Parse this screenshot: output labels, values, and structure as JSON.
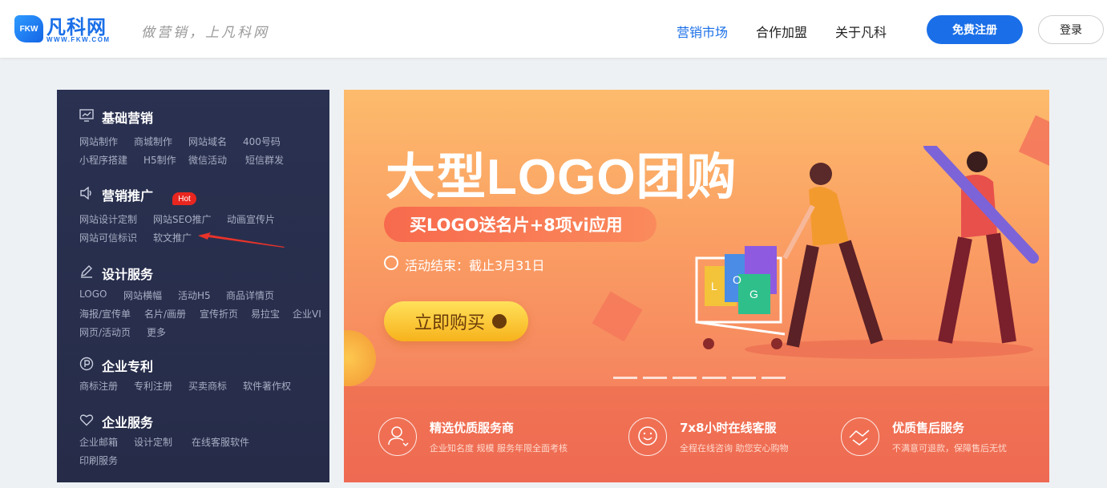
{
  "header": {
    "logo_badge": "FKW",
    "logo_name": "凡科网",
    "logo_url": "WWW.FKW.COM",
    "slogan": "做营销，上凡科网",
    "nav": [
      "营销市场",
      "合作加盟",
      "关于凡科"
    ],
    "register_label": "免费注册",
    "login_label": "登录"
  },
  "sidebar": {
    "categories": [
      {
        "title": "基础营销",
        "icon": "chart-icon",
        "links": [
          "网站制作",
          "商城制作",
          "网站域名",
          "400号码",
          "小程序搭建",
          "H5制作",
          "微信活动",
          "短信群发"
        ]
      },
      {
        "title": "营销推广",
        "icon": "speaker-icon",
        "links": [
          "网站设计定制",
          "网站SEO推广",
          "动画宣传片",
          "网站可信标识",
          "软文推广"
        ]
      },
      {
        "title": "设计服务",
        "icon": "pen-icon",
        "links": [
          "LOGO",
          "网站横幅",
          "活动H5",
          "商品详情页",
          "海报/宣传单",
          "名片/画册",
          "宣传折页",
          "易拉宝",
          "企业VI",
          "网页/活动页",
          "更多"
        ]
      },
      {
        "title": "企业专利",
        "icon": "patent-icon",
        "links": [
          "商标注册",
          "专利注册",
          "买卖商标",
          "软件著作权"
        ]
      },
      {
        "title": "企业服务",
        "icon": "heart-icon",
        "links": [
          "企业邮箱",
          "设计定制",
          "在线客服软件",
          "印刷服务"
        ]
      }
    ],
    "hot_badge": "Hot"
  },
  "banner": {
    "title": "大型LOGO团购",
    "subtitle": "买LOGO送名片+8项vi应用",
    "date": "活动结束：截止3月31日",
    "buy_label": "立即购买",
    "bag_letters": [
      "L",
      "O",
      "G"
    ],
    "features": [
      {
        "title": "精选优质服务商",
        "desc": "企业知名度 规模 服务年限全面考核",
        "icon": "user-heart-icon"
      },
      {
        "title": "7x8小时在线客服",
        "desc": "全程在线咨询 助您安心购物",
        "icon": "smile-chat-icon"
      },
      {
        "title": "优质售后服务",
        "desc": "不满意可退款，保障售后无忧",
        "icon": "handshake-icon"
      }
    ]
  },
  "colors": {
    "brand": "#1a6fe8",
    "sidebar_bg": "#2a3151",
    "hot": "#e8261f"
  }
}
